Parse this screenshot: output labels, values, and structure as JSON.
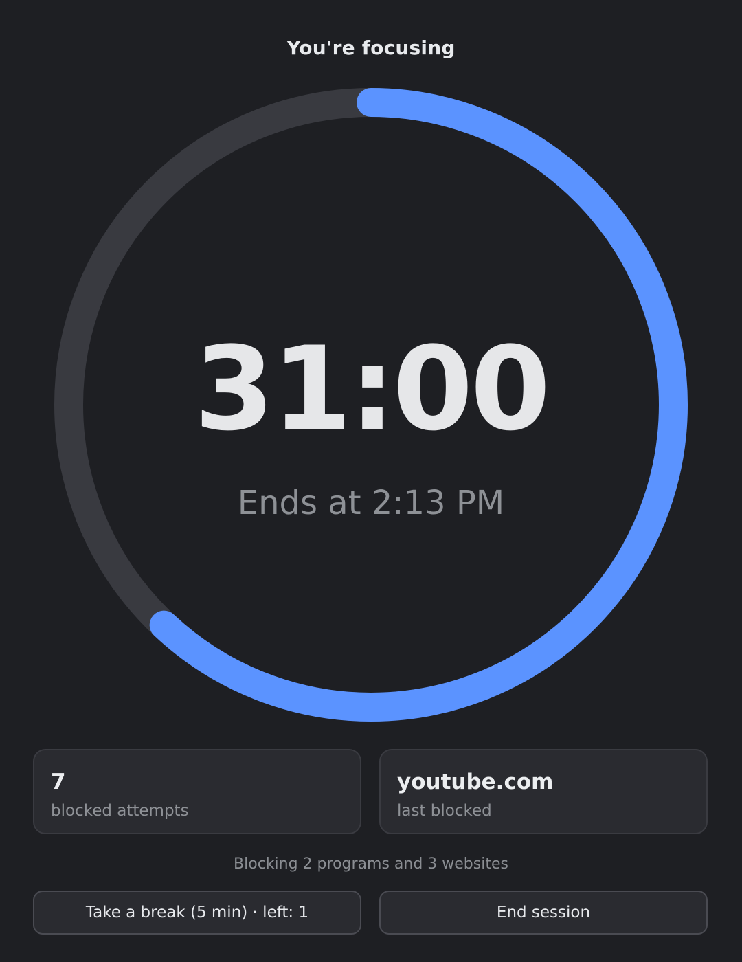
{
  "header": {
    "title": "You're focusing"
  },
  "timer": {
    "remaining": "31:00",
    "ends_at": "Ends at 2:13 PM",
    "progress_fraction": 0.62
  },
  "stats": [
    {
      "value": "7",
      "label": "blocked attempts"
    },
    {
      "value": "youtube.com",
      "label": "last blocked"
    }
  ],
  "summary": "Blocking 2 programs and 3 websites",
  "actions": {
    "break_label": "Take a break (5 min) · left: 1",
    "end_label": "End session"
  },
  "colors": {
    "accent": "#5b93ff",
    "track": "#393a40",
    "background": "#1e1f23"
  }
}
